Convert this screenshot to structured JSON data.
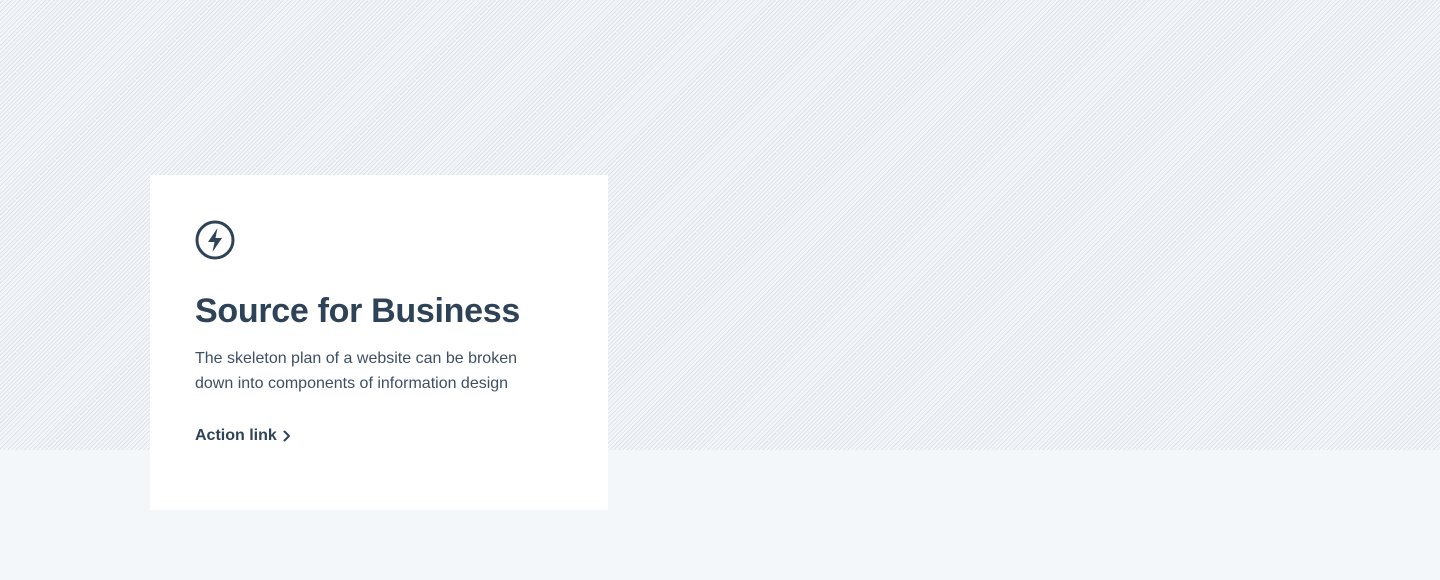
{
  "card": {
    "icon": "lightning-bolt-icon",
    "title": "Source for Business",
    "description": "The skeleton plan of a website can be broken down into components of information design",
    "action_label": "Action link",
    "action_icon": "chevron-right-icon"
  },
  "colors": {
    "text_primary": "#2e4358",
    "card_background": "#ffffff",
    "page_background": "#f4f7fa",
    "stripe": "#dde3ea"
  }
}
